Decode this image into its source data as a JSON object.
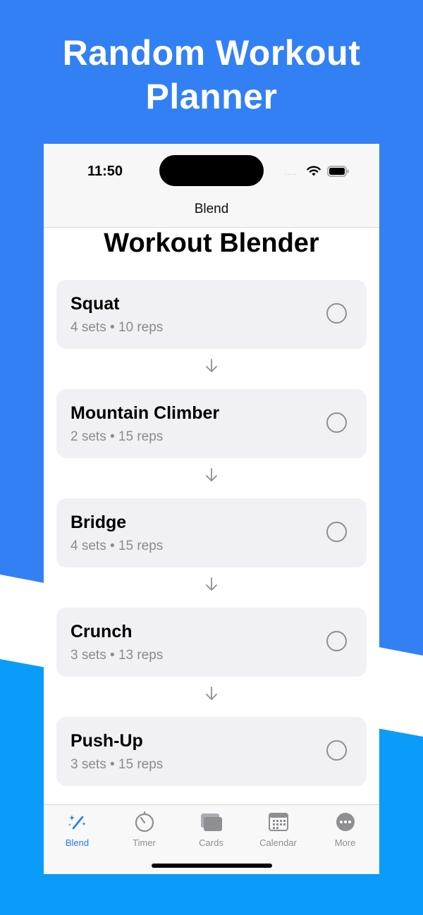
{
  "headline": {
    "line1": "Random Workout",
    "line2": "Planner"
  },
  "status_bar": {
    "time": "11:50",
    "signal": "····"
  },
  "nav": {
    "title": "Blend"
  },
  "page": {
    "title": "Workout Blender"
  },
  "exercises": [
    {
      "name": "Squat",
      "detail": "4 sets • 10 reps",
      "done": false
    },
    {
      "name": "Mountain Climber",
      "detail": "2 sets • 15 reps",
      "done": false
    },
    {
      "name": "Bridge",
      "detail": "4 sets • 15 reps",
      "done": false
    },
    {
      "name": "Crunch",
      "detail": "3 sets • 13 reps",
      "done": false
    },
    {
      "name": "Push-Up",
      "detail": "3 sets • 15 reps",
      "done": false
    }
  ],
  "tabs": [
    {
      "label": "Blend",
      "icon": "magic-wand-icon",
      "active": true
    },
    {
      "label": "Timer",
      "icon": "timer-icon",
      "active": false
    },
    {
      "label": "Cards",
      "icon": "cards-icon",
      "active": false
    },
    {
      "label": "Calendar",
      "icon": "calendar-icon",
      "active": false
    },
    {
      "label": "More",
      "icon": "more-icon",
      "active": false
    }
  ],
  "colors": {
    "background_top": "#3380f5",
    "background_bottom": "#0a9cf8",
    "accent": "#1e7cf2",
    "card": "#f1f1f5",
    "secondary_text": "#8a8a8e"
  }
}
